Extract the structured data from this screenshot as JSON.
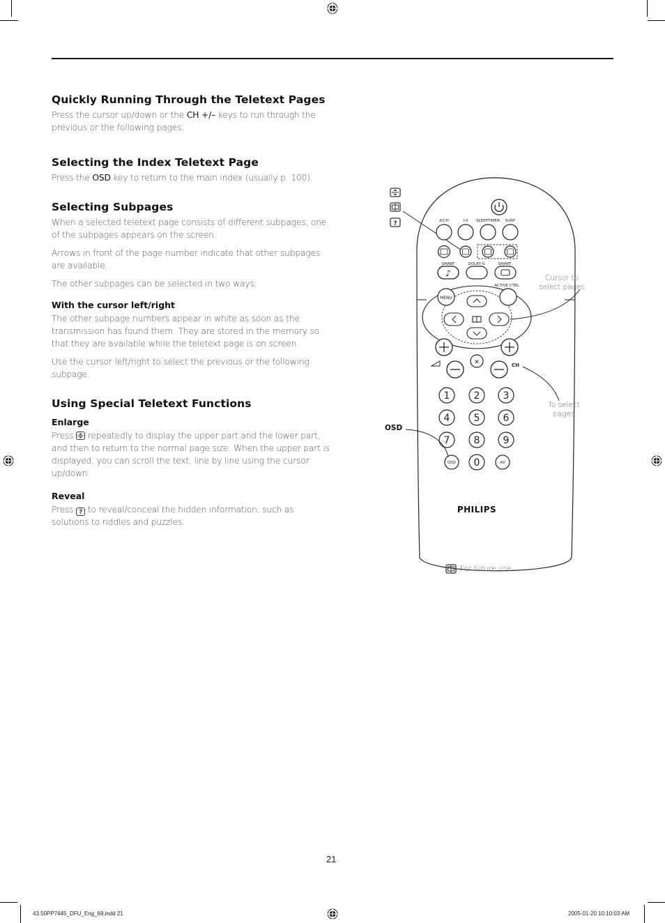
{
  "sections": [
    {
      "title": "Quickly Running Through the Teletext Pages",
      "paragraphs": [
        {
          "pre": "Press the cursor up/down or the ",
          "key": "CH +/–",
          "post": " keys to run through the previous or the following pages."
        }
      ]
    },
    {
      "title": "Selecting the Index Teletext Page",
      "paragraphs": [
        {
          "pre": "Press the ",
          "key": "OSD",
          "post": " key to return to the main index (usually p. 100)."
        }
      ]
    },
    {
      "title": "Selecting Subpages",
      "paragraphs": [
        "When a selected teletext page consists of different subpages, one of the subpages appears on the screen.",
        "Arrows in front of the page number indicate that other subpages are available.",
        "The other subpages can be selected in two ways:"
      ],
      "subsections": [
        {
          "title": "With the cursor left/right",
          "paragraphs": [
            "The other subpage numbers appear in white as soon as the transmission has found them. They are stored in the memory so that they are available while the teletext page is on screen.",
            "Use the cursor left/right to select the previous or the following subpage."
          ]
        }
      ]
    },
    {
      "title": "Using Special Teletext Functions",
      "subsections": [
        {
          "title": "Enlarge",
          "pre": "Press ",
          "icon": "enlarge-icon",
          "post": " repeatedly to display the upper part and the lower part, and then to return to the normal page size. When the upper part is displayed, you can scroll the text, line by line using the cursor up/down."
        },
        {
          "title": "Reveal",
          "pre": "Press ",
          "icon": "reveal-icon",
          "icon_glyph": "?",
          "post": " to reveal/conceal the hidden information, such as solutions to riddles and puzzles."
        }
      ]
    }
  ],
  "remote": {
    "brand": "PHILIPS",
    "top_labels": [
      "A/CH",
      "I-II",
      "SLEEPTIMER",
      "SURF"
    ],
    "mid_labels": [
      "SMART",
      "DOLBY V.",
      "SMART"
    ],
    "active_ctrl": "ACTIVE CTRL",
    "menu": "MENU",
    "ch": "CH",
    "digits": [
      "1",
      "2",
      "3",
      "4",
      "5",
      "6",
      "7",
      "8",
      "9",
      "0"
    ],
    "osd_key": "OSD",
    "av_key": "AV",
    "reveal_glyph": "?"
  },
  "callouts": {
    "cursor": "Cursor to\nselect pages",
    "to_select": "To select\npages",
    "osd": "OSD",
    "future": "For future use"
  },
  "page_number": "21",
  "footer": {
    "file": "43.50PP7445_DFU_Eng_69.indd   21",
    "timestamp": "2005-01-20   10:10:03 AM"
  }
}
